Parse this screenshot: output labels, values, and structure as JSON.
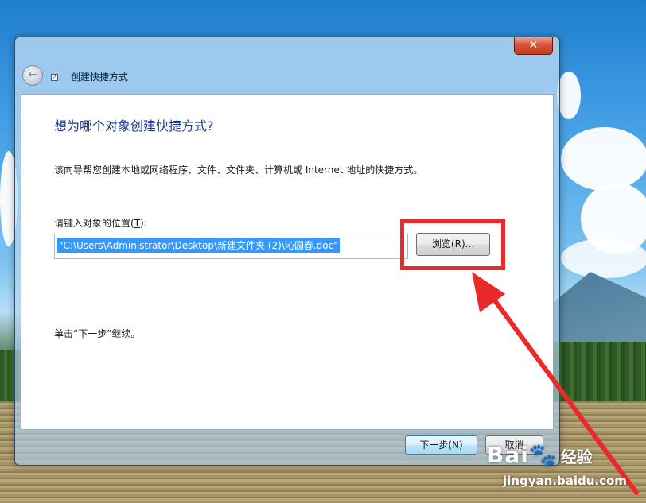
{
  "window": {
    "title": "创建快捷方式",
    "close_glyph": "✕",
    "back_glyph": "←"
  },
  "wizard": {
    "heading": "想为哪个对象创建快捷方式?",
    "description": "该向导帮您创建本地或网络程序、文件、文件夹、计算机或 Internet 地址的快捷方式。",
    "location_label_prefix": "请键入对象的位置(",
    "location_label_key": "T",
    "location_label_suffix": "):",
    "location_value": "\"C:\\Users\\Administrator\\Desktop\\新建文件夹 (2)\\沁园春.doc\"",
    "browse_label": "浏览(R)...",
    "hint": "单击“下一步”继续。"
  },
  "footer": {
    "next_label": "下一步(N)",
    "cancel_label": "取消"
  },
  "watermark": {
    "brand": "Bai",
    "brand_suffix": "经验",
    "url": "jingyan.baidu.com"
  },
  "colors": {
    "annotation_red": "#ea2a2a",
    "selection_blue": "#3399ff",
    "heading_blue": "#1d3c91"
  },
  "icons": {
    "back": "back-arrow-icon",
    "shortcut": "shortcut-icon",
    "close": "close-icon",
    "annotation_arrow": "red-arrow-icon"
  }
}
